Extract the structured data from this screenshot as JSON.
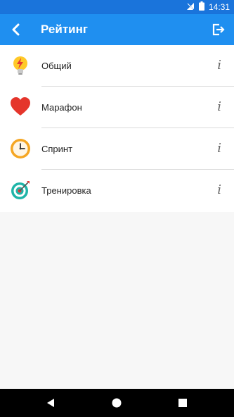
{
  "status_bar": {
    "time": "14:31",
    "icons": [
      "signal-off-icon",
      "battery-icon"
    ]
  },
  "app_bar": {
    "title": "Рейтинг",
    "back_icon": "chevron-left-icon",
    "exit_icon": "exit-icon",
    "background": "#1f8ff0"
  },
  "list": {
    "items": [
      {
        "label": "Общий",
        "icon": "lightbulb-bolt-icon",
        "info": "i"
      },
      {
        "label": "Марафон",
        "icon": "heart-icon",
        "info": "i"
      },
      {
        "label": "Спринт",
        "icon": "clock-icon",
        "info": "i"
      },
      {
        "label": "Тренировка",
        "icon": "dart-target-icon",
        "info": "i"
      }
    ]
  },
  "nav_bar": {
    "buttons": [
      "back-triangle-icon",
      "home-circle-icon",
      "recents-square-icon"
    ]
  }
}
